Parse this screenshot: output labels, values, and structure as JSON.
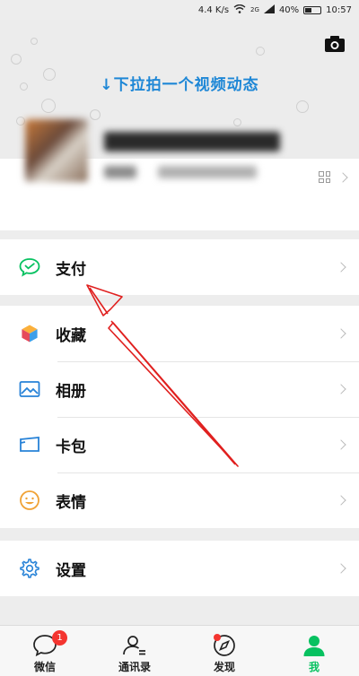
{
  "status_bar": {
    "speed": "4.4 K/s",
    "network": "2G",
    "battery": "40%",
    "time": "10:57"
  },
  "header": {
    "pull_hint": "↓下拉拍一个视频动态"
  },
  "menu": {
    "pay": "支付",
    "favorites": "收藏",
    "album": "相册",
    "cards": "卡包",
    "stickers": "表情",
    "settings": "设置"
  },
  "tabbar": {
    "chats": "微信",
    "chats_badge": "1",
    "contacts": "通讯录",
    "discover": "发现",
    "me": "我"
  },
  "colors": {
    "accent_green": "#07c160",
    "hint_blue": "#1e87d6",
    "annotation_red": "#e0201f",
    "badge_red": "#f43530"
  }
}
